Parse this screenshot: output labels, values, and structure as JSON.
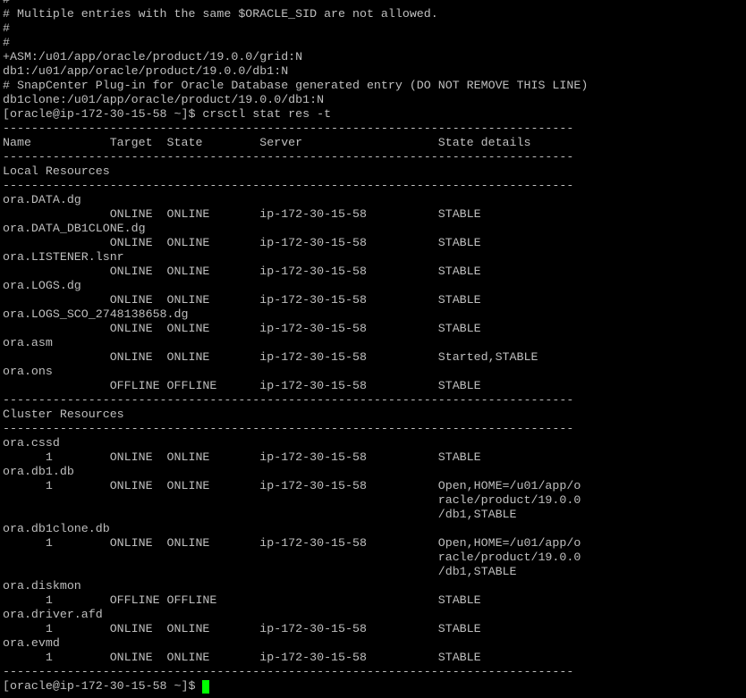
{
  "terminal": {
    "background": "#000000",
    "foreground": "#bfbfbf",
    "cursor_color": "#00ff00",
    "lines": [
      "#",
      "# Multiple entries with the same $ORACLE_SID are not allowed.",
      "#",
      "#",
      "+ASM:/u01/app/oracle/product/19.0.0/grid:N",
      "db1:/u01/app/oracle/product/19.0.0/db1:N",
      "# SnapCenter Plug-in for Oracle Database generated entry (DO NOT REMOVE THIS LINE)",
      "db1clone:/u01/app/oracle/product/19.0.0/db1:N",
      "[oracle@ip-172-30-15-58 ~]$ crsctl stat res -t",
      "--------------------------------------------------------------------------------",
      "Name           Target  State        Server                   State details",
      "--------------------------------------------------------------------------------",
      "Local Resources",
      "--------------------------------------------------------------------------------",
      "ora.DATA.dg",
      "               ONLINE  ONLINE       ip-172-30-15-58          STABLE",
      "ora.DATA_DB1CLONE.dg",
      "               ONLINE  ONLINE       ip-172-30-15-58          STABLE",
      "ora.LISTENER.lsnr",
      "               ONLINE  ONLINE       ip-172-30-15-58          STABLE",
      "ora.LOGS.dg",
      "               ONLINE  ONLINE       ip-172-30-15-58          STABLE",
      "ora.LOGS_SCO_2748138658.dg",
      "               ONLINE  ONLINE       ip-172-30-15-58          STABLE",
      "ora.asm",
      "               ONLINE  ONLINE       ip-172-30-15-58          Started,STABLE",
      "ora.ons",
      "               OFFLINE OFFLINE      ip-172-30-15-58          STABLE",
      "--------------------------------------------------------------------------------",
      "Cluster Resources",
      "--------------------------------------------------------------------------------",
      "ora.cssd",
      "      1        ONLINE  ONLINE       ip-172-30-15-58          STABLE",
      "ora.db1.db",
      "      1        ONLINE  ONLINE       ip-172-30-15-58          Open,HOME=/u01/app/o",
      "                                                             racle/product/19.0.0",
      "                                                             /db1,STABLE",
      "ora.db1clone.db",
      "      1        ONLINE  ONLINE       ip-172-30-15-58          Open,HOME=/u01/app/o",
      "                                                             racle/product/19.0.0",
      "                                                             /db1,STABLE",
      "ora.diskmon",
      "      1        OFFLINE OFFLINE                               STABLE",
      "ora.driver.afd",
      "      1        ONLINE  ONLINE       ip-172-30-15-58          STABLE",
      "ora.evmd",
      "      1        ONLINE  ONLINE       ip-172-30-15-58          STABLE",
      "--------------------------------------------------------------------------------"
    ],
    "prompt": "[oracle@ip-172-30-15-58 ~]$ "
  }
}
